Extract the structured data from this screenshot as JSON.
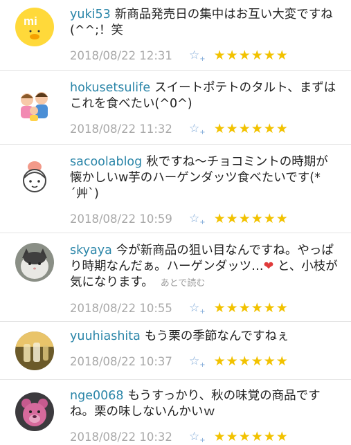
{
  "comments": [
    {
      "user": "yuki53",
      "text": "新商品発売日の集中はお互い大変ですね(^^;！笑",
      "date": "2018/08/22 12:31",
      "stars": "★★★★★★",
      "avatar": "mi-duck-logo"
    },
    {
      "user": "hokusetsulife",
      "text": "スイートポテトのタルト、まずはこれを食べたい(^0^)",
      "date": "2018/08/22 11:32",
      "stars": "★★★★★★",
      "avatar": "family-illustration"
    },
    {
      "user": "sacoolablog",
      "text": "秋ですね〜チョコミントの時期が懐かしいw芋のハーゲンダッツ食べたいです(*´艸`)",
      "date": "2018/08/22 10:59",
      "stars": "★★★★★★",
      "avatar": "girl-illustration"
    },
    {
      "user": "skyaya",
      "text_before": "今が新商品の狙い目なんですね。やっぱり時期なんだぁ。ハーゲンダッツ…",
      "heart": "❤",
      "text_after": " と、小枝が気になります。",
      "later": "あとで読む",
      "date": "2018/08/22 10:55",
      "stars": "★★★★★★",
      "avatar": "cat-photo"
    },
    {
      "user": "yuuhiashita",
      "text": "もう栗の季節なんですねぇ",
      "date": "2018/08/22 10:37",
      "stars": "★★★★★★",
      "avatar": "glasses-photo"
    },
    {
      "user": "nge0068",
      "text": "もうすっかり、秋の味覚の商品ですね。栗の味しないんかいｗ",
      "date": "2018/08/22 10:32",
      "stars": "★★★★★★",
      "avatar": "pink-bear-photo"
    }
  ],
  "add_star_icon": "☆",
  "add_star_plus": "+",
  "colors": {
    "username": "#2a85a8",
    "star": "#f2c200",
    "add_star": "#7fa9d8",
    "date": "#a9a9a9"
  }
}
